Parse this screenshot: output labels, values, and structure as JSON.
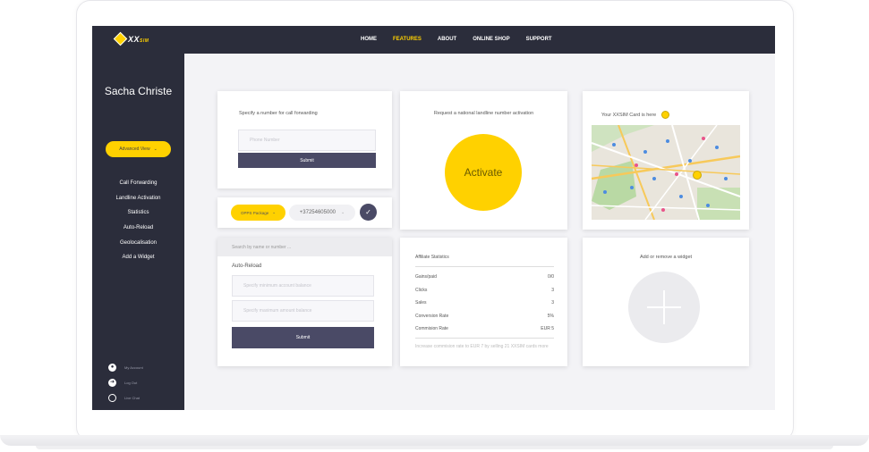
{
  "nav": {
    "logo_text": "XX",
    "logo_sub": "SIM",
    "links": [
      "HOME",
      "FEATURES",
      "ABOUT",
      "ONLINE SHOP",
      "SUPPORT"
    ],
    "active": "FEATURES"
  },
  "sidebar": {
    "user_name": "Sacha Christe",
    "view_button": "Advanced View",
    "menu": [
      "Call Forwarding",
      "Landline Activation",
      "Statistics",
      "Auto-Reload",
      "Geolocalisation",
      "Add a Widget"
    ],
    "account": [
      "My Account",
      "Log Out",
      "Live Chat"
    ]
  },
  "call_forwarding": {
    "title": "Specify a number for call forwarding",
    "phone_placeholder": "Phone Number",
    "submit": "Submit"
  },
  "package_bar": {
    "package": "OPPS Package",
    "number": "+37254605000"
  },
  "auto_reload": {
    "search_placeholder": "Search by name or number ...",
    "title": "Auto-Reload",
    "field1_placeholder": "Specify minimum account balance",
    "field2_placeholder": "Specify maximum amount balance",
    "submit": "Submit"
  },
  "landline": {
    "title": "Request a national landline number activation",
    "activate": "Activate"
  },
  "map_card": {
    "title": "Your XXSIM Card is here"
  },
  "affiliate": {
    "title": "Affiliate Statistics",
    "rows": [
      {
        "label": "Gains/paid",
        "value": "0/0"
      },
      {
        "label": "Clicks",
        "value": "3"
      },
      {
        "label": "Sales",
        "value": "3"
      },
      {
        "label": "Conversion Rate",
        "value": "5%"
      },
      {
        "label": "Commision Rate",
        "value": "EUR 5"
      }
    ],
    "note": "Increase commision rate to EUR 7 by selling 21 XXSIM cards more"
  },
  "widget": {
    "title": "Add or remove a widget"
  },
  "colors": {
    "brand_dark": "#2b2d3b",
    "accent_yellow": "#ffd100",
    "button_dark": "#4a4a66"
  }
}
